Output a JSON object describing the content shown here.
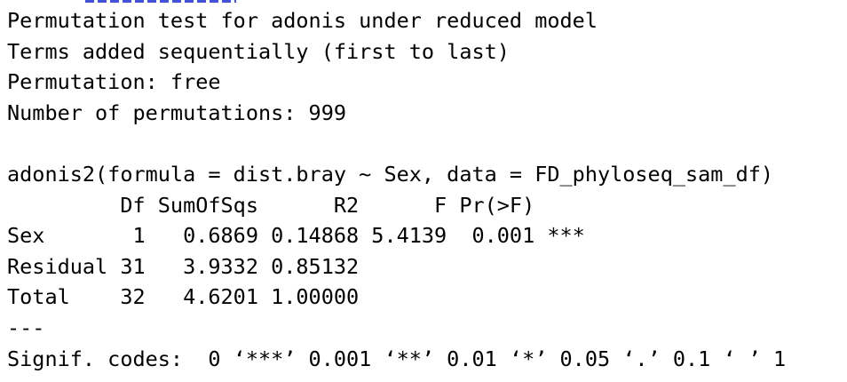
{
  "console": {
    "header_lines": [
      "Permutation test for adonis under reduced model",
      "Terms added sequentially (first to last)",
      "Permutation: free",
      "Number of permutations: 999"
    ],
    "call": "adonis2(formula = dist.bray ~ Sex, data = FD_phyloseq_sam_df)",
    "table": {
      "header": "         Df SumOfSqs      R2      F Pr(>F)    ",
      "rows": [
        "Sex       1   0.6869 0.14868 5.4139  0.001 ***",
        "Residual 31   3.9332 0.85132              ",
        "Total    32   4.6201 1.00000              "
      ]
    },
    "separator": "---",
    "signif_codes": "Signif. codes:  0 ‘***’ 0.001 ‘**’ 0.01 ‘*’ 0.05 ‘.’ 0.1 ‘ ’ 1"
  }
}
